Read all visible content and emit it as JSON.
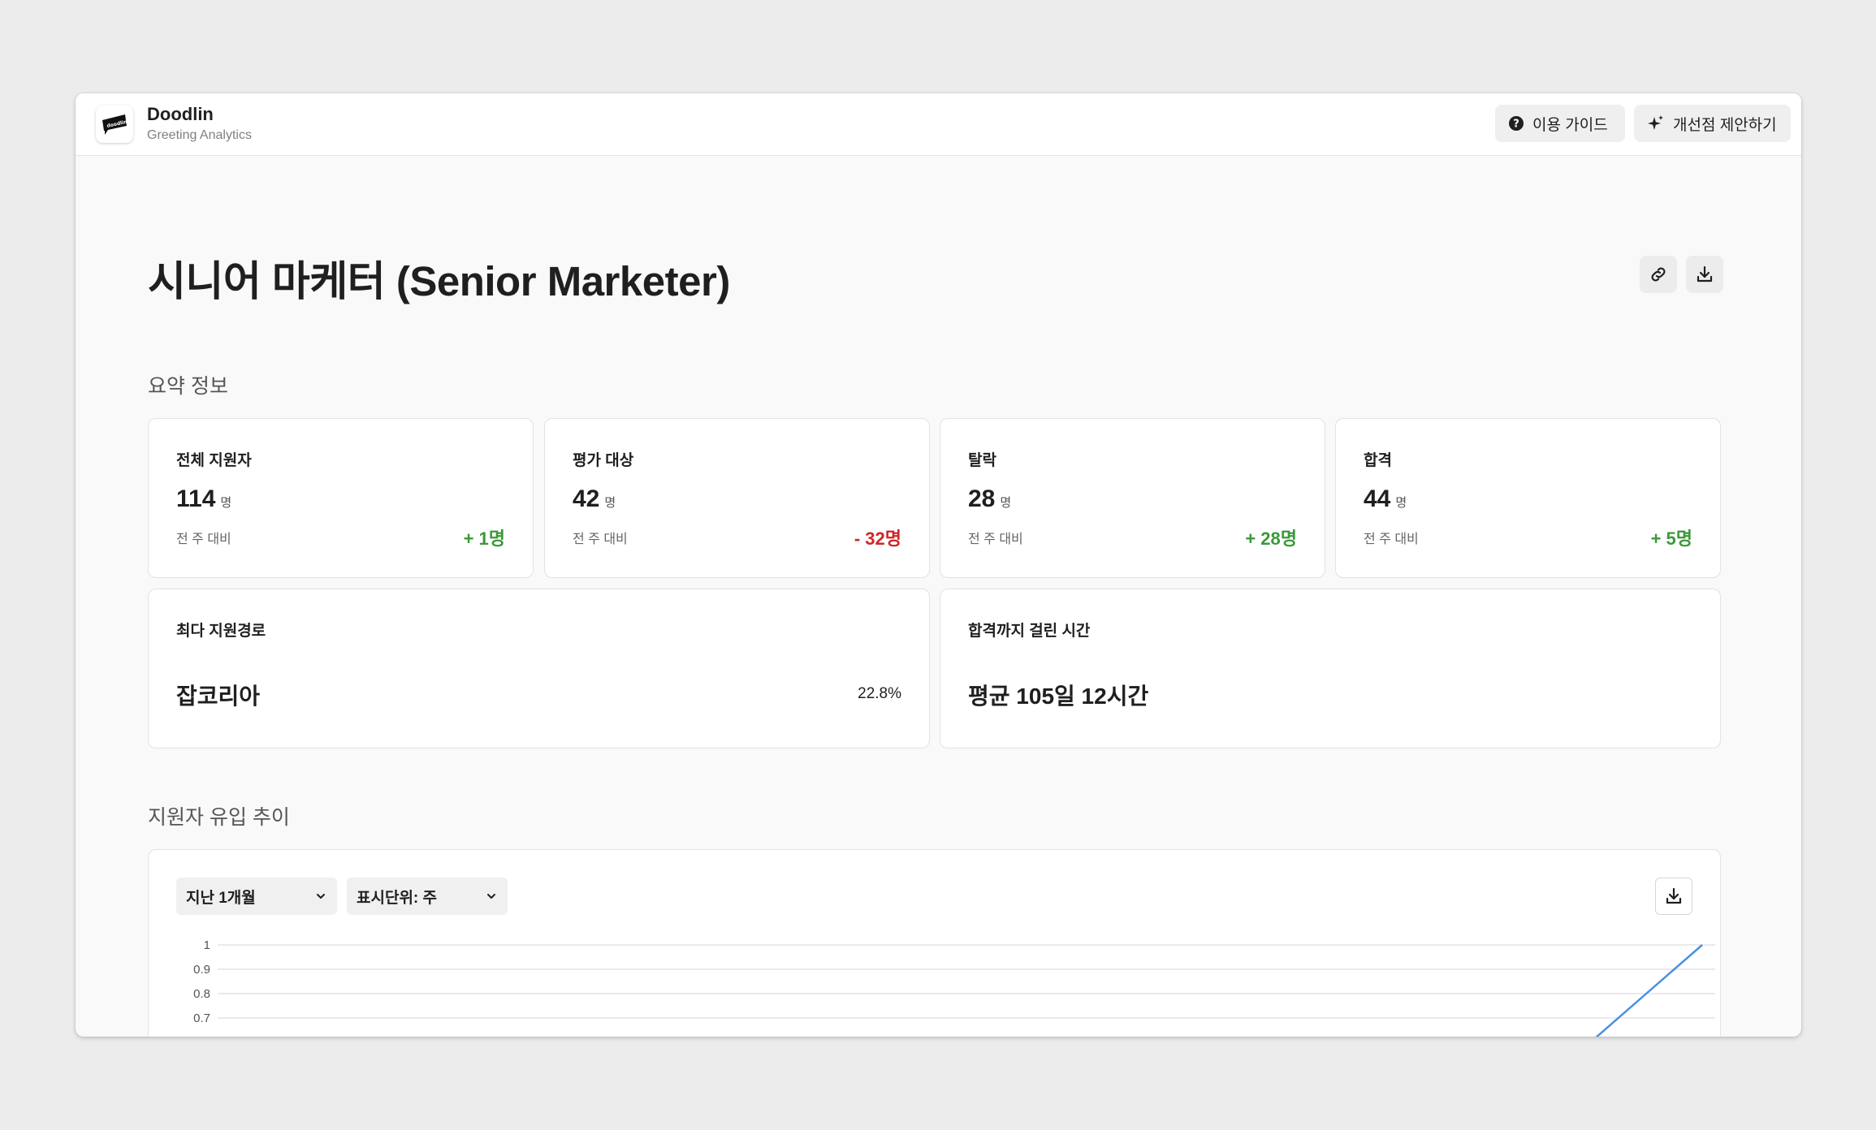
{
  "header": {
    "brand_name": "Doodlin",
    "brand_subtitle": "Greeting Analytics",
    "logo_text": "doodlin",
    "guide_label": "이용 가이드",
    "suggest_label": "개선점 제안하기"
  },
  "page": {
    "title": "시니어 마케터 (Senior Marketer)"
  },
  "summary": {
    "section_title": "요약 정보",
    "stats": [
      {
        "label": "전체 지원자",
        "value": "114",
        "unit": "명",
        "compare": "전 주 대비",
        "delta": "+ 1명",
        "color": "#3a9a3a"
      },
      {
        "label": "평가 대상",
        "value": "42",
        "unit": "명",
        "compare": "전 주 대비",
        "delta": "- 32명",
        "color": "#d02525"
      },
      {
        "label": "탈락",
        "value": "28",
        "unit": "명",
        "compare": "전 주 대비",
        "delta": "+ 28명",
        "color": "#3a9a3a"
      },
      {
        "label": "합격",
        "value": "44",
        "unit": "명",
        "compare": "전 주 대비",
        "delta": "+ 5명",
        "color": "#3a9a3a"
      }
    ],
    "top_channel": {
      "label": "최다 지원경로",
      "value": "잡코리아",
      "percent": "22.8%"
    },
    "time_to_hire": {
      "label": "합격까지 걸린 시간",
      "value": "평균 105일 12시간"
    }
  },
  "trend": {
    "section_title": "지원자 유입 추이",
    "period_select": "지난 1개월",
    "unit_select": "표시단위: 주"
  },
  "chart_data": {
    "type": "line",
    "y_ticks": [
      "1",
      "0.9",
      "0.8",
      "0.7"
    ],
    "ylim_visible": [
      0.65,
      1
    ],
    "line_color": "#4a90e2",
    "series": [
      {
        "values": [
          {
            "t": 0.0,
            "y": 0.0
          },
          {
            "t": 0.8,
            "y": 0.0
          },
          {
            "t": 1.0,
            "y": 1
          }
        ]
      }
    ],
    "grid": true
  }
}
